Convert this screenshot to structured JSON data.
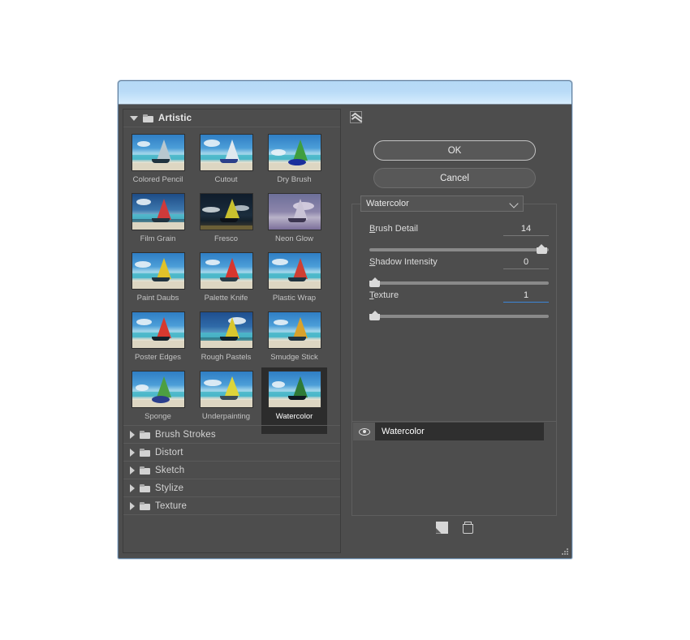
{
  "dialog": {
    "titlebar_color": "#bcdcf8",
    "background_color": "#4d4d4d"
  },
  "browser": {
    "expanded_category": {
      "name": "Artistic",
      "expander_icon": "triangle-down-icon",
      "folder_icon": "folder-icon"
    },
    "filters": [
      {
        "label": "Colored Pencil",
        "selected": false
      },
      {
        "label": "Cutout",
        "selected": false
      },
      {
        "label": "Dry Brush",
        "selected": false
      },
      {
        "label": "Film Grain",
        "selected": false
      },
      {
        "label": "Fresco",
        "selected": false
      },
      {
        "label": "Neon Glow",
        "selected": false
      },
      {
        "label": "Paint Daubs",
        "selected": false
      },
      {
        "label": "Palette Knife",
        "selected": false
      },
      {
        "label": "Plastic Wrap",
        "selected": false
      },
      {
        "label": "Poster Edges",
        "selected": false
      },
      {
        "label": "Rough Pastels",
        "selected": false
      },
      {
        "label": "Smudge Stick",
        "selected": false
      },
      {
        "label": "Sponge",
        "selected": false
      },
      {
        "label": "Underpainting",
        "selected": false
      },
      {
        "label": "Watercolor",
        "selected": true
      }
    ],
    "collapsed_categories": [
      {
        "label": "Brush Strokes",
        "expander_icon": "triangle-right-icon",
        "folder_icon": "folder-icon"
      },
      {
        "label": "Distort",
        "expander_icon": "triangle-right-icon",
        "folder_icon": "folder-icon"
      },
      {
        "label": "Sketch",
        "expander_icon": "triangle-right-icon",
        "folder_icon": "folder-icon"
      },
      {
        "label": "Stylize",
        "expander_icon": "triangle-right-icon",
        "folder_icon": "folder-icon"
      },
      {
        "label": "Texture",
        "expander_icon": "triangle-right-icon",
        "folder_icon": "folder-icon"
      }
    ]
  },
  "controls": {
    "collapse_icon": "double-chevron-up-icon",
    "ok_label": "OK",
    "cancel_label": "Cancel",
    "filter_select": {
      "value": "Watercolor",
      "caret_icon": "chevron-down-icon"
    },
    "parameters": [
      {
        "label_prefix": "B",
        "label_rest": "rush Detail",
        "value": "14",
        "min": 1,
        "max": 14,
        "percent": 96,
        "focused": false
      },
      {
        "label_prefix": "S",
        "label_rest": "hadow Intensity",
        "value": "0",
        "min": 0,
        "max": 10,
        "percent": 1,
        "focused": false
      },
      {
        "label_prefix": "T",
        "label_rest": "exture",
        "value": "1",
        "min": 1,
        "max": 3,
        "percent": 1,
        "focused": true,
        "focus_color": "#3d86d8"
      }
    ]
  },
  "layers": {
    "items": [
      {
        "name": "Watercolor",
        "visible": true,
        "visibility_icon": "eye-icon",
        "selected": true
      }
    ],
    "new_layer_icon": "new-effect-layer-icon",
    "delete_icon": "trash-icon"
  },
  "resize_grip_icon": "resize-grip-icon"
}
